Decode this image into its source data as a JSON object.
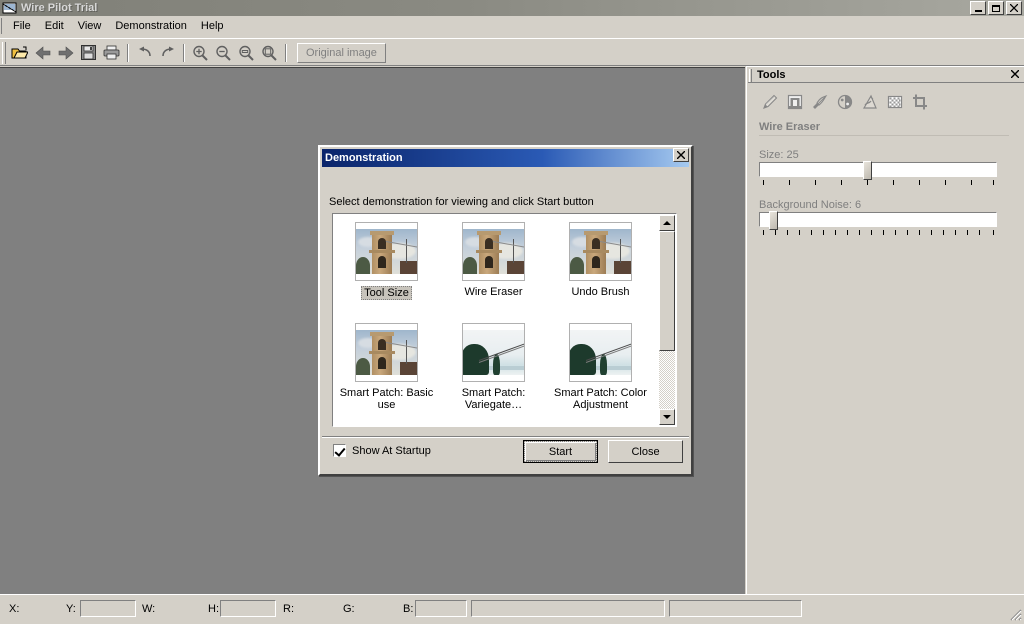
{
  "window": {
    "title": "Wire Pilot Trial",
    "app_icon": "app-icon",
    "minimize_label": "_",
    "maximize_label": "",
    "close_label": "✕"
  },
  "menubar": {
    "items": [
      {
        "label": "File"
      },
      {
        "label": "Edit"
      },
      {
        "label": "View"
      },
      {
        "label": "Demonstration"
      },
      {
        "label": "Help"
      }
    ]
  },
  "toolbar": {
    "buttons": [
      {
        "name": "open-icon",
        "title": "Open"
      },
      {
        "name": "back-arrow-icon",
        "title": "Back"
      },
      {
        "name": "forward-arrow-icon",
        "title": "Forward"
      },
      {
        "name": "save-icon",
        "title": "Save"
      },
      {
        "name": "print-icon",
        "title": "Print"
      },
      {
        "name": "undo-icon",
        "title": "Undo"
      },
      {
        "name": "redo-icon",
        "title": "Redo"
      },
      {
        "name": "zoom-in-icon",
        "title": "Zoom In"
      },
      {
        "name": "zoom-out-icon",
        "title": "Zoom Out"
      },
      {
        "name": "zoom-fit-icon",
        "title": "Zoom to Fit"
      },
      {
        "name": "zoom-actual-icon",
        "title": "Actual Size"
      }
    ],
    "original_image_label": "Original image"
  },
  "tools_panel": {
    "title": "Tools",
    "close_label": "✕",
    "tool_icons": [
      {
        "name": "pencil-tool-icon",
        "label": "Pencil"
      },
      {
        "name": "wire-eraser-tool-icon",
        "label": "Wire Eraser"
      },
      {
        "name": "smart-patch-tool-icon",
        "label": "Smart Patch"
      },
      {
        "name": "color-adjust-tool-icon",
        "label": "Color Adjustment"
      },
      {
        "name": "undo-brush-tool-icon",
        "label": "Undo Brush"
      },
      {
        "name": "checker-mask-tool-icon",
        "label": "Mask"
      },
      {
        "name": "crop-tool-icon",
        "label": "Crop"
      }
    ],
    "active_tool_name": "Wire Eraser",
    "sliders": [
      {
        "name": "size-slider",
        "label": "Size: 25",
        "value": 25,
        "percent": 45,
        "ticks": 10
      },
      {
        "name": "background-noise-slider",
        "label": "Background Noise: 6",
        "value": 6,
        "percent": 4,
        "ticks": 20
      }
    ]
  },
  "dialog": {
    "title": "Demonstration",
    "close_label": "✕",
    "instruction": "Select demonstration for viewing and click Start button",
    "demos": [
      {
        "caption": "Tool Size",
        "thumb": "tower",
        "selected": true
      },
      {
        "caption": "Wire Eraser",
        "thumb": "tower",
        "selected": false
      },
      {
        "caption": "Undo Brush",
        "thumb": "tower",
        "selected": false
      },
      {
        "caption": "Smart Patch: Basic use",
        "thumb": "tower",
        "selected": false
      },
      {
        "caption": "Smart Patch: Variegate…",
        "thumb": "wire",
        "selected": false
      },
      {
        "caption": "Smart Patch: Color Adjustment",
        "thumb": "wire",
        "selected": false
      }
    ],
    "scroll": {
      "up_arrow": "▲",
      "down_arrow": "▼"
    },
    "show_at_startup": {
      "label": "Show At Startup",
      "checked": true
    },
    "start_button": "Start",
    "close_button": "Close"
  },
  "statusbar": {
    "fields": [
      {
        "name": "x-label",
        "label": "X:",
        "value": ""
      },
      {
        "name": "y-label",
        "label": "Y:",
        "value": ""
      },
      {
        "name": "w-label",
        "label": "W:",
        "value": ""
      },
      {
        "name": "h-label",
        "label": "H:",
        "value": ""
      },
      {
        "name": "r-label",
        "label": "R:",
        "value": ""
      },
      {
        "name": "g-label",
        "label": "G:",
        "value": ""
      },
      {
        "name": "b-label",
        "label": "B:",
        "value": ""
      }
    ],
    "message": ""
  },
  "colors": {
    "window_bg": "#d4d0c8",
    "canvas_bg": "#808080",
    "dialog_title_start": "#0a246a",
    "dialog_title_end": "#a6caf0",
    "disabled_text": "#7f7f7f"
  }
}
